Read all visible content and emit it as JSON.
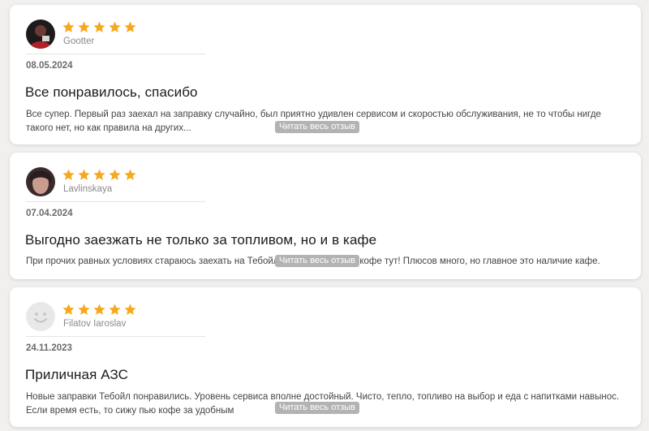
{
  "colors": {
    "star": "#f7a81c",
    "card_bg": "#ffffff",
    "page_bg": "#f1f0ef",
    "read_button_bg": "#b3b3b3"
  },
  "read_more_label": "Читать весь отзыв",
  "reviews": [
    {
      "author": "Gootter",
      "rating": 5,
      "date": "08.05.2024",
      "title": "Все понравилось, спасибо",
      "text": "Все супер. Первый раз заехал на заправку случайно, был приятно удивлен сервисом и скоростью обслуживания, не то чтобы нигде такого нет, но как правила на других..."
    },
    {
      "author": "Lavlinskaya",
      "rating": 5,
      "date": "07.04.2024",
      "title": "Выгодно заезжать не только за топливом, но и в кафе",
      "text": "При прочих равных условиях стараюсь заехать на Тебойл, так как знаю, что кофе тут! Плюсов много, но главное это наличие кафе."
    },
    {
      "author": "Filatov Iaroslav",
      "rating": 5,
      "date": "24.11.2023",
      "title": "Приличная АЗС",
      "text": "Новые заправки Тебойл понравились. Уровень сервиса вполне достойный. Чисто, тепло, топливо на выбор и еда с напитками навынос. Если время есть, то сижу пью кофе за удобным"
    }
  ]
}
